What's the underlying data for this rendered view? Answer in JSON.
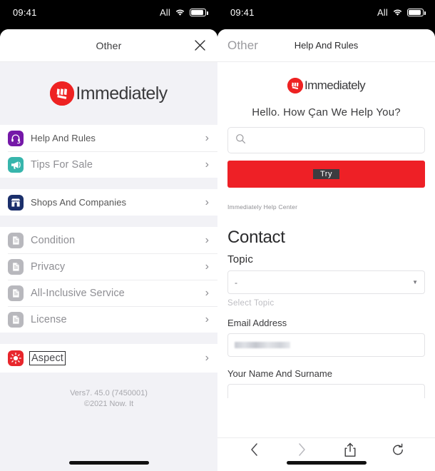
{
  "status_bar": {
    "time": "09:41",
    "carrier": "All",
    "wifi_icon": "wifi-icon",
    "battery_icon": "battery-icon"
  },
  "colors": {
    "brand_red": "#ee2026",
    "list_bg": "#f2f2f6",
    "muted_text": "#9a9a9e"
  },
  "left_panel": {
    "nav": {
      "title": "Other",
      "close_icon": "close-icon"
    },
    "brand": {
      "name": "Immediately",
      "mark_icon": "brand-logo-icon"
    },
    "groups": [
      {
        "items": [
          {
            "label": "Help And Rules",
            "icon": "headset-icon",
            "icon_color": "#7518a8",
            "chevron": "chevron-right-icon"
          },
          {
            "label": "Tips For Sale",
            "icon": "megaphone-icon",
            "icon_color": "#37b5ac",
            "chevron": "chevron-right-icon"
          }
        ]
      },
      {
        "items": [
          {
            "label": "Shops And Companies",
            "icon": "store-icon",
            "icon_color": "#1b2f6b",
            "chevron": "chevron-right-icon"
          }
        ]
      },
      {
        "items": [
          {
            "label": "Condition",
            "icon": "document-icon",
            "icon_color": "#b8b8bd",
            "chevron": "chevron-right-icon"
          },
          {
            "label": "Privacy",
            "icon": "document-icon",
            "icon_color": "#b8b8bd",
            "chevron": "chevron-right-icon"
          },
          {
            "label": "All-Inclusive Service",
            "icon": "document-icon",
            "icon_color": "#b8b8bd",
            "chevron": "chevron-right-icon"
          },
          {
            "label": "License",
            "icon": "document-icon",
            "icon_color": "#b8b8bd",
            "chevron": "chevron-right-icon"
          }
        ]
      },
      {
        "items": [
          {
            "label": "Aspect",
            "icon": "brightness-icon",
            "icon_color": "#e8262c",
            "chevron": "chevron-right-icon"
          }
        ]
      }
    ],
    "footer": {
      "version": "Vers7. 45.0 (7450001)",
      "copyright": "©2021 Now. It"
    }
  },
  "right_panel": {
    "nav": {
      "back_label": "Other",
      "title": "Help And Rules"
    },
    "brand": {
      "name": "Immediately",
      "mark_icon": "brand-logo-icon"
    },
    "heading": "Hello. How Çan We Help You?",
    "search": {
      "icon": "search-icon",
      "value": "",
      "placeholder": ""
    },
    "primary_button": "Try",
    "breadcrumb": "Immediately Help Center",
    "contact": {
      "heading": "Contact",
      "topic_label": "Topic",
      "topic_value": "-",
      "topic_arrow_icon": "chevron-down-icon",
      "topic_helper": "Select Topic",
      "email_label": "Email Address",
      "email_value": "",
      "name_label": "Your Name And Surname",
      "name_value": ""
    },
    "toolbar": {
      "back_icon": "chevron-left-icon",
      "forward_icon": "chevron-right-icon",
      "share_icon": "share-icon",
      "reload_icon": "reload-icon"
    }
  }
}
